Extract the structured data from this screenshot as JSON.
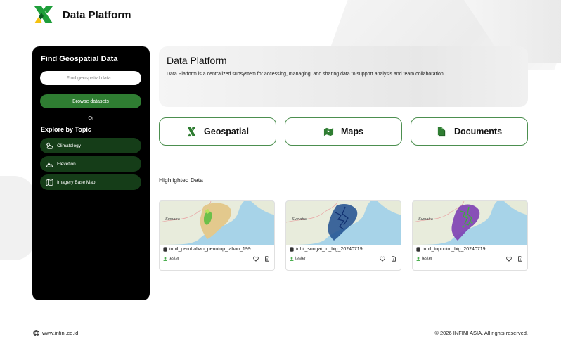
{
  "header": {
    "brand": "Data Platform"
  },
  "sidebar": {
    "title": "Find Geospatial Data",
    "search_placeholder": "Find geospatial data...",
    "browse_label": "Browse datasets",
    "or_label": "Or",
    "topics_title": "Explore by Topic",
    "topics": [
      {
        "label": "Climatology",
        "icon": "weather-icon"
      },
      {
        "label": "Elevetion",
        "icon": "mountain-icon"
      },
      {
        "label": "Imagery Base Map",
        "icon": "map-icon"
      }
    ]
  },
  "hero": {
    "title": "Data Platform",
    "description": "Data Platform is a centralized subsystem for accessing, managing, and sharing data to support analysis and team collaboration"
  },
  "categories": [
    {
      "label": "Geospatial",
      "icon": "geospatial-icon"
    },
    {
      "label": "Maps",
      "icon": "map-pin-icon"
    },
    {
      "label": "Documents",
      "icon": "document-icon"
    }
  ],
  "highlighted": {
    "title": "Highlighted Data",
    "map_label": "Sumatra",
    "cards": [
      {
        "title": "inhil_perubahan_penutup_lahan_199...",
        "user": "tester"
      },
      {
        "title": "inhil_sungai_ln_big_20240719",
        "user": "tester"
      },
      {
        "title": "inhil_toponim_big_20240719",
        "user": "tester"
      }
    ]
  },
  "footer": {
    "website": "www.infini.co.id",
    "copyright": "© 2026 INFINI ASIA. All rights reserved."
  },
  "colors": {
    "accent": "#2f7d32",
    "topic_bg": "#153d18",
    "sidebar_bg": "#000000",
    "brand_green": "#1e9e3a",
    "brand_yellow": "#f4c10f"
  }
}
